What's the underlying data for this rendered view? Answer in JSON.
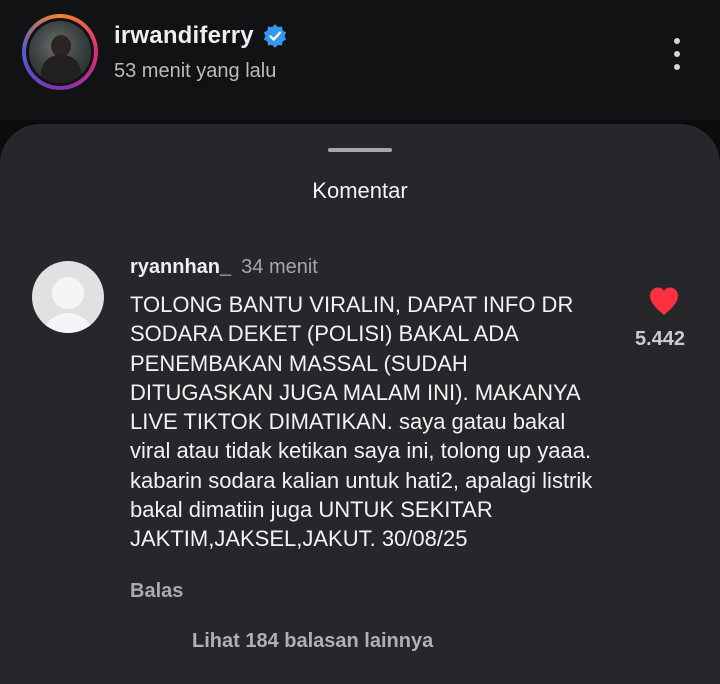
{
  "post": {
    "username": "irwandiferry",
    "time_ago": "53 menit yang lalu"
  },
  "sheet": {
    "title": "Komentar"
  },
  "comment": {
    "username": "ryannhan_",
    "time": "34 menit",
    "text": "TOLONG BANTU VIRALIN, DAPAT INFO DR SODARA DEKET (POLISI) BAKAL ADA PENEMBAKAN MASSAL (SUDAH DITUGASKAN JUGA MALAM INI). MAKANYA LIVE TIKTOK DIMATIKAN. saya gatau bakal viral atau tidak ketikan saya ini, tolong up yaaa. kabarin sodara kalian untuk hati2, apalagi listrik bakal dimatiin juga UNTUK SEKITAR JAKTIM,JAKSEL,JAKUT. 30/08/25",
    "like_count": "5.442",
    "reply_label": "Balas",
    "more_replies": "Lihat 184 balasan lainnya"
  },
  "icons": {
    "verified": "verified-badge-icon",
    "more": "more-vertical-icon",
    "like": "heart-filled-icon"
  },
  "colors": {
    "background": "#0c0c0d",
    "sheet": "#26272a",
    "verified_blue": "#3797f0",
    "like_red": "#ff3040"
  }
}
